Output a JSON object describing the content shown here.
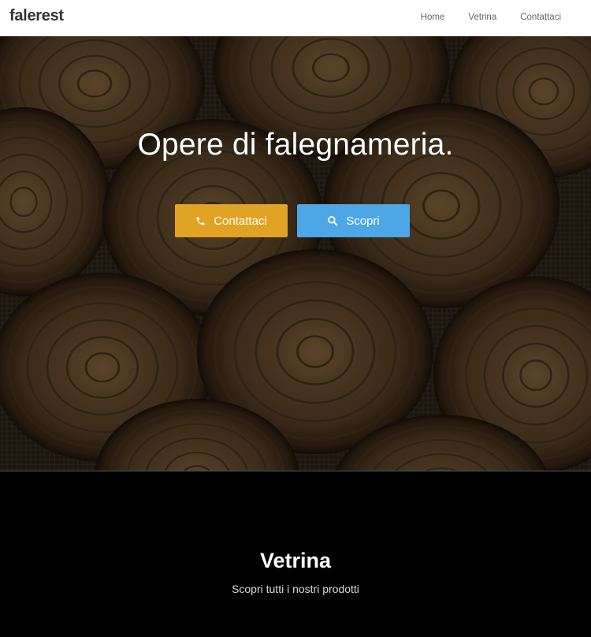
{
  "brand": "falerest",
  "nav": {
    "home": "Home",
    "vetrina": "Vetrina",
    "contattaci": "Contattaci"
  },
  "hero": {
    "title": "Opere di falegnameria.",
    "buttons": {
      "contact_label": "Contattaci",
      "contact_icon": "phone-icon",
      "discover_label": "Scopri",
      "discover_icon": "search-icon"
    }
  },
  "section": {
    "title": "Vetrina",
    "subtitle": "Scopri tutti i nostri prodotti"
  },
  "colors": {
    "accent_orange": "#e0a323",
    "accent_blue": "#4da6e6",
    "navbar_bg": "#ffffff",
    "section_bg": "#000000"
  }
}
